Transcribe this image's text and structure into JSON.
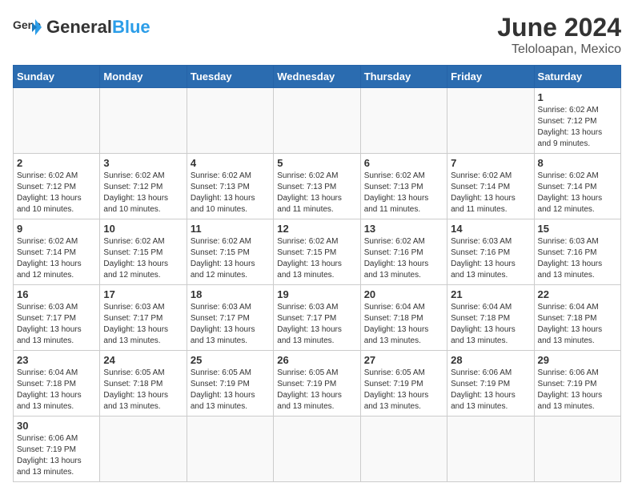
{
  "header": {
    "logo_general": "General",
    "logo_blue": "Blue",
    "month_year": "June 2024",
    "location": "Teloloapan, Mexico"
  },
  "days_of_week": [
    "Sunday",
    "Monday",
    "Tuesday",
    "Wednesday",
    "Thursday",
    "Friday",
    "Saturday"
  ],
  "weeks": [
    [
      {
        "day": "",
        "info": ""
      },
      {
        "day": "",
        "info": ""
      },
      {
        "day": "",
        "info": ""
      },
      {
        "day": "",
        "info": ""
      },
      {
        "day": "",
        "info": ""
      },
      {
        "day": "",
        "info": ""
      },
      {
        "day": "1",
        "info": "Sunrise: 6:02 AM\nSunset: 7:12 PM\nDaylight: 13 hours and 9 minutes."
      }
    ],
    [
      {
        "day": "2",
        "info": "Sunrise: 6:02 AM\nSunset: 7:12 PM\nDaylight: 13 hours and 10 minutes."
      },
      {
        "day": "3",
        "info": "Sunrise: 6:02 AM\nSunset: 7:12 PM\nDaylight: 13 hours and 10 minutes."
      },
      {
        "day": "4",
        "info": "Sunrise: 6:02 AM\nSunset: 7:13 PM\nDaylight: 13 hours and 10 minutes."
      },
      {
        "day": "5",
        "info": "Sunrise: 6:02 AM\nSunset: 7:13 PM\nDaylight: 13 hours and 11 minutes."
      },
      {
        "day": "6",
        "info": "Sunrise: 6:02 AM\nSunset: 7:13 PM\nDaylight: 13 hours and 11 minutes."
      },
      {
        "day": "7",
        "info": "Sunrise: 6:02 AM\nSunset: 7:14 PM\nDaylight: 13 hours and 11 minutes."
      },
      {
        "day": "8",
        "info": "Sunrise: 6:02 AM\nSunset: 7:14 PM\nDaylight: 13 hours and 12 minutes."
      }
    ],
    [
      {
        "day": "9",
        "info": "Sunrise: 6:02 AM\nSunset: 7:14 PM\nDaylight: 13 hours and 12 minutes."
      },
      {
        "day": "10",
        "info": "Sunrise: 6:02 AM\nSunset: 7:15 PM\nDaylight: 13 hours and 12 minutes."
      },
      {
        "day": "11",
        "info": "Sunrise: 6:02 AM\nSunset: 7:15 PM\nDaylight: 13 hours and 12 minutes."
      },
      {
        "day": "12",
        "info": "Sunrise: 6:02 AM\nSunset: 7:15 PM\nDaylight: 13 hours and 13 minutes."
      },
      {
        "day": "13",
        "info": "Sunrise: 6:02 AM\nSunset: 7:16 PM\nDaylight: 13 hours and 13 minutes."
      },
      {
        "day": "14",
        "info": "Sunrise: 6:03 AM\nSunset: 7:16 PM\nDaylight: 13 hours and 13 minutes."
      },
      {
        "day": "15",
        "info": "Sunrise: 6:03 AM\nSunset: 7:16 PM\nDaylight: 13 hours and 13 minutes."
      }
    ],
    [
      {
        "day": "16",
        "info": "Sunrise: 6:03 AM\nSunset: 7:17 PM\nDaylight: 13 hours and 13 minutes."
      },
      {
        "day": "17",
        "info": "Sunrise: 6:03 AM\nSunset: 7:17 PM\nDaylight: 13 hours and 13 minutes."
      },
      {
        "day": "18",
        "info": "Sunrise: 6:03 AM\nSunset: 7:17 PM\nDaylight: 13 hours and 13 minutes."
      },
      {
        "day": "19",
        "info": "Sunrise: 6:03 AM\nSunset: 7:17 PM\nDaylight: 13 hours and 13 minutes."
      },
      {
        "day": "20",
        "info": "Sunrise: 6:04 AM\nSunset: 7:18 PM\nDaylight: 13 hours and 13 minutes."
      },
      {
        "day": "21",
        "info": "Sunrise: 6:04 AM\nSunset: 7:18 PM\nDaylight: 13 hours and 13 minutes."
      },
      {
        "day": "22",
        "info": "Sunrise: 6:04 AM\nSunset: 7:18 PM\nDaylight: 13 hours and 13 minutes."
      }
    ],
    [
      {
        "day": "23",
        "info": "Sunrise: 6:04 AM\nSunset: 7:18 PM\nDaylight: 13 hours and 13 minutes."
      },
      {
        "day": "24",
        "info": "Sunrise: 6:05 AM\nSunset: 7:18 PM\nDaylight: 13 hours and 13 minutes."
      },
      {
        "day": "25",
        "info": "Sunrise: 6:05 AM\nSunset: 7:19 PM\nDaylight: 13 hours and 13 minutes."
      },
      {
        "day": "26",
        "info": "Sunrise: 6:05 AM\nSunset: 7:19 PM\nDaylight: 13 hours and 13 minutes."
      },
      {
        "day": "27",
        "info": "Sunrise: 6:05 AM\nSunset: 7:19 PM\nDaylight: 13 hours and 13 minutes."
      },
      {
        "day": "28",
        "info": "Sunrise: 6:06 AM\nSunset: 7:19 PM\nDaylight: 13 hours and 13 minutes."
      },
      {
        "day": "29",
        "info": "Sunrise: 6:06 AM\nSunset: 7:19 PM\nDaylight: 13 hours and 13 minutes."
      }
    ],
    [
      {
        "day": "30",
        "info": "Sunrise: 6:06 AM\nSunset: 7:19 PM\nDaylight: 13 hours and 13 minutes."
      },
      {
        "day": "",
        "info": ""
      },
      {
        "day": "",
        "info": ""
      },
      {
        "day": "",
        "info": ""
      },
      {
        "day": "",
        "info": ""
      },
      {
        "day": "",
        "info": ""
      },
      {
        "day": "",
        "info": ""
      }
    ]
  ]
}
